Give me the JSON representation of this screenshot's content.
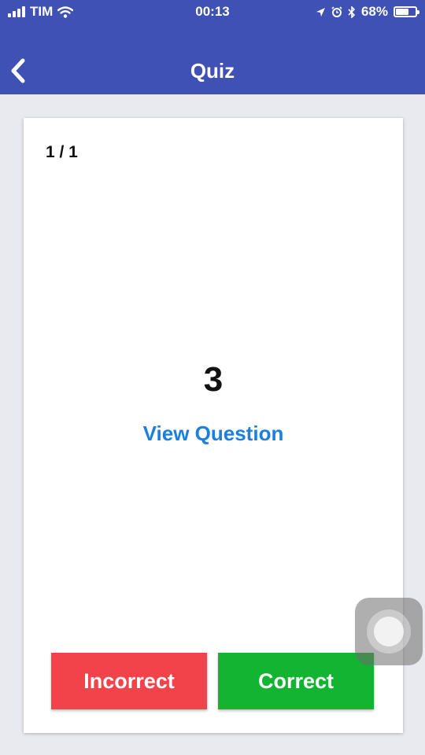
{
  "status_bar": {
    "carrier": "TIM",
    "time": "00:13",
    "battery_percent": "68%",
    "battery_level": 0.68,
    "icons": [
      "signal-icon",
      "wifi-icon",
      "location-arrow-icon",
      "alarm-icon",
      "bluetooth-icon",
      "battery-icon"
    ]
  },
  "nav": {
    "title": "Quiz",
    "back_icon": "chevron-left-icon"
  },
  "card": {
    "counter": "1 / 1",
    "answer": "3",
    "view_question": "View Question"
  },
  "buttons": {
    "incorrect": "Incorrect",
    "correct": "Correct"
  },
  "colors": {
    "nav_bg": "#3f51b5",
    "incorrect_bg": "#f2434a",
    "correct_bg": "#12b431",
    "link": "#1a7fe0"
  }
}
